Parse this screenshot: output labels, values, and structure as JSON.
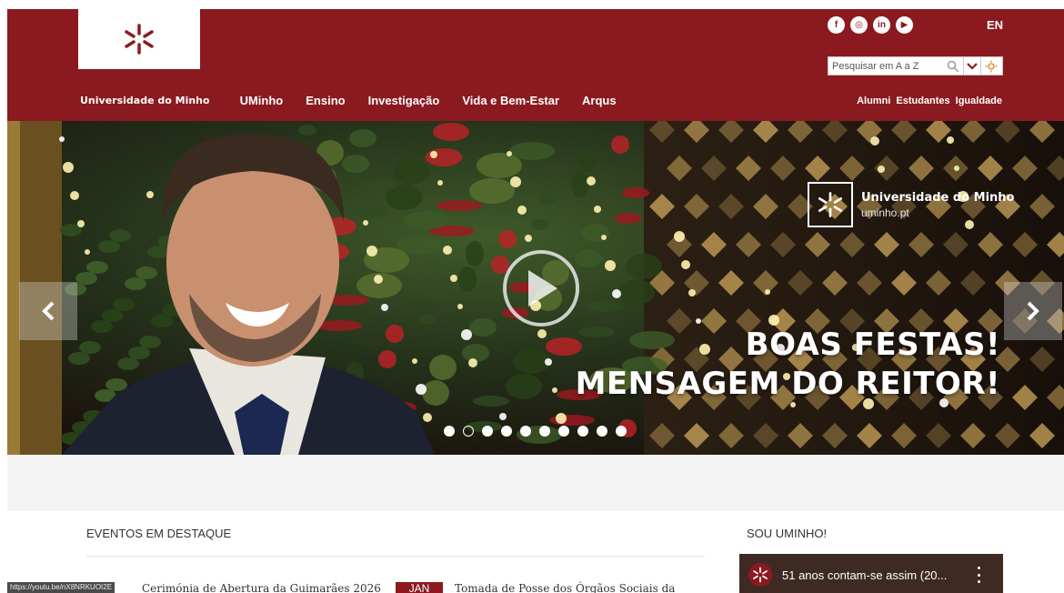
{
  "header": {
    "social_icons": [
      {
        "name": "facebook-icon",
        "glyph": "f"
      },
      {
        "name": "instagram-icon",
        "glyph": "◎"
      },
      {
        "name": "linkedin-icon",
        "glyph": "in"
      },
      {
        "name": "youtube-icon",
        "glyph": "▶"
      }
    ],
    "lang": "EN",
    "search": {
      "placeholder": "Pesquisar em A a Z"
    },
    "nav": [
      {
        "label": "Universidade do Minho"
      },
      {
        "label": "UMinho"
      },
      {
        "label": "Ensino"
      },
      {
        "label": "Investigação"
      },
      {
        "label": "Vida e Bem-Estar"
      },
      {
        "label": "Arqus"
      }
    ],
    "subnav": [
      {
        "label": "Alumni"
      },
      {
        "label": "Estudantes"
      },
      {
        "label": "Igualdade"
      }
    ]
  },
  "hero": {
    "logo_name": "Universidade do Minho",
    "logo_url": "uminho.pt",
    "title_line1": "BOAS FESTAS!",
    "title_line2": "MENSAGEM DO REITOR!",
    "slide_count": 10,
    "active_slide": 2
  },
  "sections": {
    "events_title": "EVENTOS EM DESTAQUE",
    "sou_title": "SOU UMINHO!"
  },
  "status_url": "https://youtu.be/nX8NRKUOI2E",
  "events": [
    {
      "title": "Cerimónia de Abertura da Guimarães 2026"
    },
    {
      "month": "JAN",
      "title": "Tomada de Posse dos Órgãos Sociais da"
    }
  ],
  "video": {
    "title": "51 anos contam-se assim (20..."
  },
  "colors": {
    "brand": "#8b1a20",
    "grey_band": "#f3f3f3"
  }
}
